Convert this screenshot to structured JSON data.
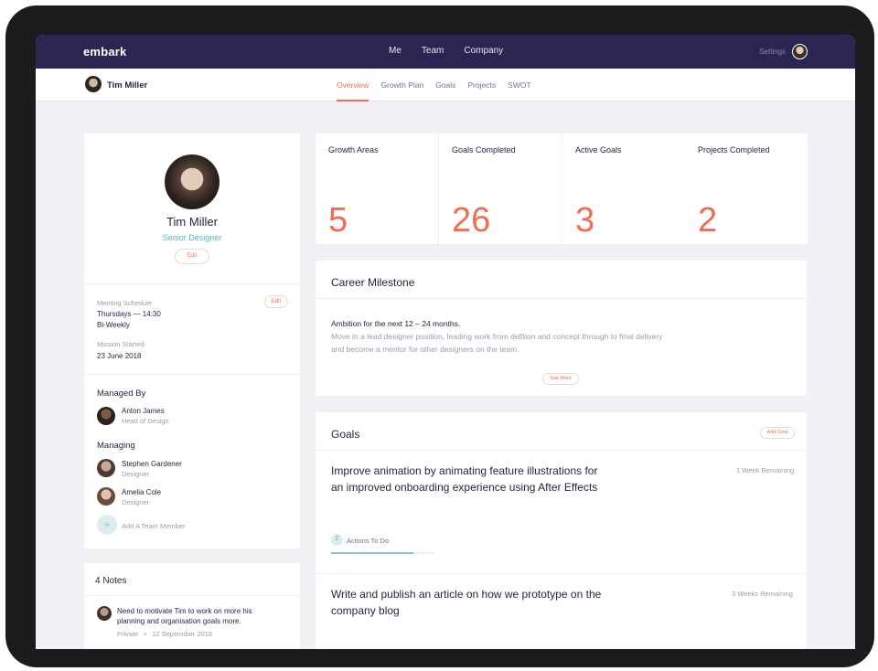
{
  "app": {
    "brand": "embark"
  },
  "topnav": {
    "items": [
      "Me",
      "Team",
      "Company"
    ],
    "settings_label": "Settings"
  },
  "subnav": {
    "user_name": "Tim Miller",
    "tabs": [
      "Overview",
      "Growth Plan",
      "Goals",
      "Projects",
      "SWOT"
    ],
    "active_tab": "Overview"
  },
  "profile": {
    "name": "Tim Miller",
    "role": "Senior Designer",
    "edit_label": "Edit",
    "meeting_label": "Meeting Schedule",
    "meeting_edit": "Edit",
    "meeting_day": "Thursdays — 14:30",
    "meeting_freq": "Bi-Weekly",
    "mission_label": "Mission Started",
    "mission_date": "23 June 2018",
    "managed_by_title": "Managed By",
    "manager": {
      "name": "Anton James",
      "role": "Head of Design"
    },
    "managing_title": "Managing",
    "reports": [
      {
        "name": "Stephen Gardener",
        "role": "Designer"
      },
      {
        "name": "Amelia Cole",
        "role": "Designer"
      }
    ],
    "add_member_label": "Add A Team Member",
    "add_icon": "+"
  },
  "notes": {
    "title": "4 Notes",
    "items": [
      {
        "text": "Need to motivate Tim to work on more his planning and organisation goals more.",
        "visibility": "Private",
        "separator": "•",
        "date": "12 September 2018"
      }
    ]
  },
  "stats": [
    {
      "label": "Growth Areas",
      "value": "5"
    },
    {
      "label": "Goals Completed",
      "value": "26"
    },
    {
      "label": "Active Goals",
      "value": "3"
    },
    {
      "label": "Projects Completed",
      "value": "2"
    }
  ],
  "milestone": {
    "title": "Career Milestone",
    "ambition": "Ambition for the next 12 – 24 months.",
    "line1": "Move in a lead designer position, leading work from defition and concept through to final delivery",
    "line2": "and become a mentor for other designers on the team.",
    "see_more": "See More"
  },
  "goals": {
    "title": "Goals",
    "add_label": "Add Goal",
    "items": [
      {
        "line1": "Improve animation by animating feature illustrations for",
        "line2": "an improved onboarding experience using After Effects",
        "remaining": "1 Week Remaining",
        "actions_count": "2",
        "actions_label": "Actions To Do",
        "progress": 0.8
      },
      {
        "line1": "Write and publish an article on how we prototype on the",
        "line2": "company blog",
        "remaining": "3 Weeks Remaining"
      }
    ]
  },
  "colors": {
    "accent": "#ef6e53",
    "teal": "#4fb4bf",
    "navbar": "#2b2651"
  }
}
